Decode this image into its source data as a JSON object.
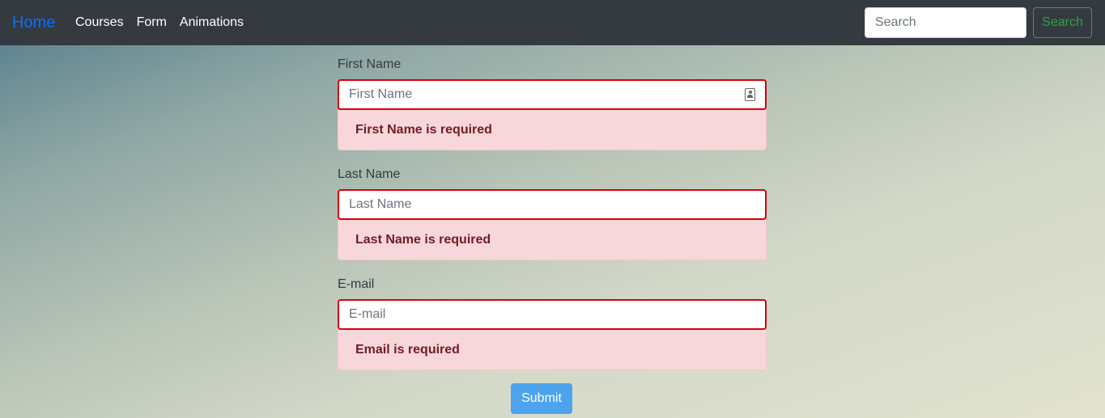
{
  "navbar": {
    "brand": "Home",
    "links": [
      "Courses",
      "Form",
      "Animations"
    ],
    "search_placeholder": "Search",
    "search_button": "Search"
  },
  "form": {
    "first_name": {
      "label": "First Name",
      "placeholder": "First Name",
      "value": "",
      "error": "First Name is required",
      "icon": "contact-card-icon"
    },
    "last_name": {
      "label": "Last Name",
      "placeholder": "Last Name",
      "value": "",
      "error": "Last Name is required"
    },
    "email": {
      "label": "E-mail",
      "placeholder": "E-mail",
      "value": "",
      "error": "Email is required"
    },
    "submit_label": "Submit"
  },
  "colors": {
    "navbar_bg": "#343a40",
    "brand": "#0d6efd",
    "search_button": "#28a745",
    "error_border": "#d9000d",
    "error_bg": "#f8d7da",
    "error_text": "#721c24",
    "submit_bg": "#4da3ee"
  }
}
